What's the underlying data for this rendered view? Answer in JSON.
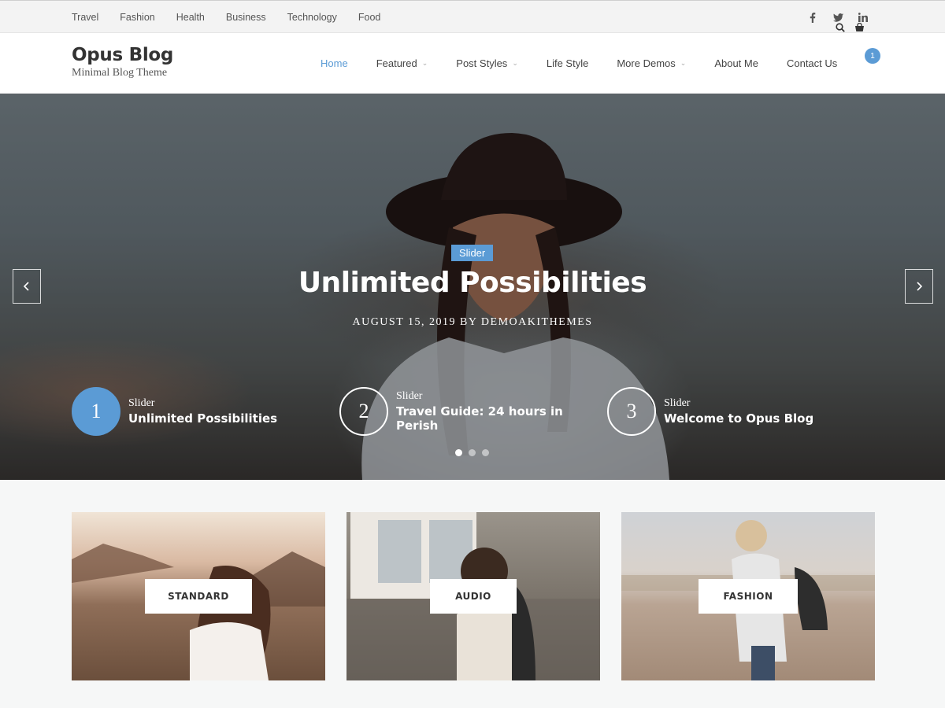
{
  "topbar": {
    "links": [
      "Travel",
      "Fashion",
      "Health",
      "Business",
      "Technology",
      "Food"
    ],
    "social": [
      "facebook-icon",
      "twitter-icon",
      "linkedin-icon"
    ]
  },
  "header": {
    "site_title": "Opus Blog",
    "tagline": "Minimal Blog Theme",
    "nav": [
      {
        "label": "Home",
        "active": true
      },
      {
        "label": "Featured",
        "dropdown": true
      },
      {
        "label": "Post Styles",
        "dropdown": true
      },
      {
        "label": "Life Style"
      },
      {
        "label": "More Demos",
        "dropdown": true
      },
      {
        "label": "About Me"
      },
      {
        "label": "Contact Us"
      }
    ],
    "cart_count": "1"
  },
  "hero": {
    "category": "Slider",
    "title": "Unlimited Possibilities",
    "meta": "AUGUST 15, 2019   BY DEMOAKITHEMES",
    "slides": [
      {
        "num": "1",
        "label": "Slider",
        "title": "Unlimited Possibilities",
        "active": true
      },
      {
        "num": "2",
        "label": "Slider",
        "title": "Travel Guide: 24 hours in Perish"
      },
      {
        "num": "3",
        "label": "Slider",
        "title": "Welcome to Opus Blog"
      }
    ],
    "active_dot": 1,
    "dot_count": 3
  },
  "cards": [
    {
      "label": "STANDARD"
    },
    {
      "label": "AUDIO"
    },
    {
      "label": "FASHION"
    }
  ],
  "colors": {
    "accent": "#5b9bd5"
  }
}
